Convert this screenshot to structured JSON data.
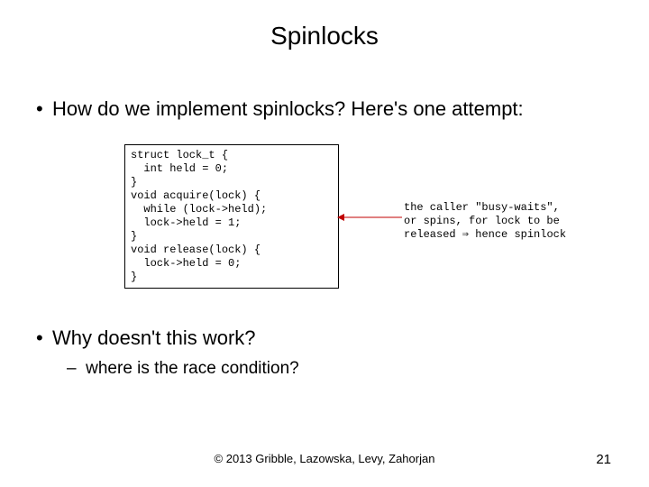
{
  "title": "Spinlocks",
  "bullets": {
    "b1": {
      "marker": "•",
      "text": "How do we implement spinlocks?  Here's one attempt:"
    },
    "b2": {
      "marker": "•",
      "text": "Why doesn't this work?"
    },
    "sub": {
      "marker": "–",
      "text": "where is the race condition?"
    }
  },
  "code": "struct lock_t {\n  int held = 0;\n}\nvoid acquire(lock) {\n  while (lock->held);\n  lock->held = 1;\n}\nvoid release(lock) {\n  lock->held = 0;\n}",
  "annotation": {
    "l1": "the caller \"busy-waits\",",
    "l2": "or spins, for lock to be",
    "l3": "released ⇒ hence spinlock"
  },
  "footer": "© 2013 Gribble, Lazowska, Levy, Zahorjan",
  "page": "21"
}
